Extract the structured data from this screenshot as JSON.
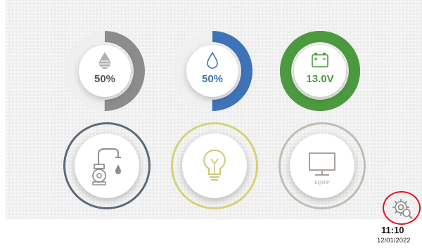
{
  "gauges": [
    {
      "name": "grey-water-tank",
      "value_text": "50%",
      "level": 0.5,
      "color": "#8c8c8c",
      "track": "#efefef",
      "text_color": "#555555",
      "icon": "water-drop-icon"
    },
    {
      "name": "fresh-water-tank",
      "value_text": "50%",
      "level": 0.5,
      "color": "#3f73b8",
      "track": "#f0f0f0",
      "text_color": "#3f73b8",
      "icon": "water-drop-outline-icon"
    },
    {
      "name": "battery",
      "value_text": "13.0V",
      "level": 1.0,
      "color": "#4c9a3f",
      "track": "#4c9a3f",
      "text_color": "#4c9a3f",
      "icon": "battery-icon"
    }
  ],
  "buttons": [
    {
      "name": "water-pump-button",
      "ring_color": "#5d6a78",
      "icon": "faucet-icon"
    },
    {
      "name": "lights-button",
      "ring_color": "#d4d27a",
      "icon": "lightbulb-icon"
    },
    {
      "name": "equipment-button",
      "ring_color": "#c2bcb3",
      "icon": "monitor-icon",
      "label": "EQUIP"
    }
  ],
  "settings": {
    "icon": "gear-search-icon",
    "highlight_color": "#e2151b"
  },
  "status": {
    "time": "11:10",
    "date": "12/01/2022"
  }
}
